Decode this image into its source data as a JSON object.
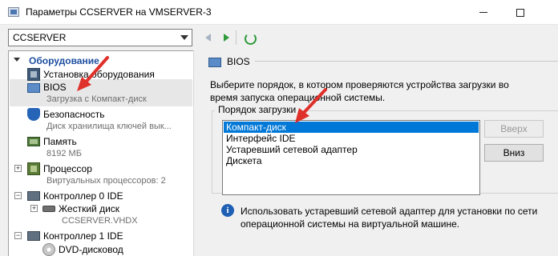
{
  "window": {
    "title": "Параметры CCSERVER на VMSERVER-3",
    "minimize_glyph": "",
    "maximize_glyph": ""
  },
  "toolbar": {
    "vm_select_value": "CCSERVER"
  },
  "tree": {
    "section_label": "Оборудование",
    "items": [
      {
        "label": "Установка оборудования"
      },
      {
        "label": "BIOS",
        "sub": "Загрузка с Компакт-диск"
      },
      {
        "label": "Безопасность",
        "sub": "Диск хранилища ключей вык..."
      },
      {
        "label": "Память",
        "sub": "8192 МБ"
      },
      {
        "label": "Процессор",
        "sub": "Виртуальных процессоров: 2",
        "expander": "+"
      },
      {
        "label": "Контроллер 0 IDE",
        "expander": "−"
      },
      {
        "label": "Жесткий диск",
        "sub": "CCSERVER.VHDX",
        "expander": "+"
      },
      {
        "label": "Контроллер 1 IDE",
        "expander": "−"
      },
      {
        "label": "DVD-дисковод"
      }
    ]
  },
  "bios": {
    "header": "BIOS",
    "description": "Выберите порядок, в котором проверяются устройства загрузки во время запуска операционной системы.",
    "group_title": "Порядок загрузки",
    "boot_order": [
      "Компакт-диск",
      "Интерфейс IDE",
      "Устаревший сетевой адаптер",
      "Дискета"
    ],
    "selected_index": 0,
    "move_up_label": "Вверх",
    "move_down_label": "Вниз",
    "info_glyph": "i",
    "info_text": "Использовать устаревший сетевой адаптер для установки по сети операционной системы на виртуальной машине."
  },
  "colors": {
    "accent": "#0078d7",
    "section_header": "#1e4fa0",
    "annotation_arrow": "#e0302a"
  }
}
